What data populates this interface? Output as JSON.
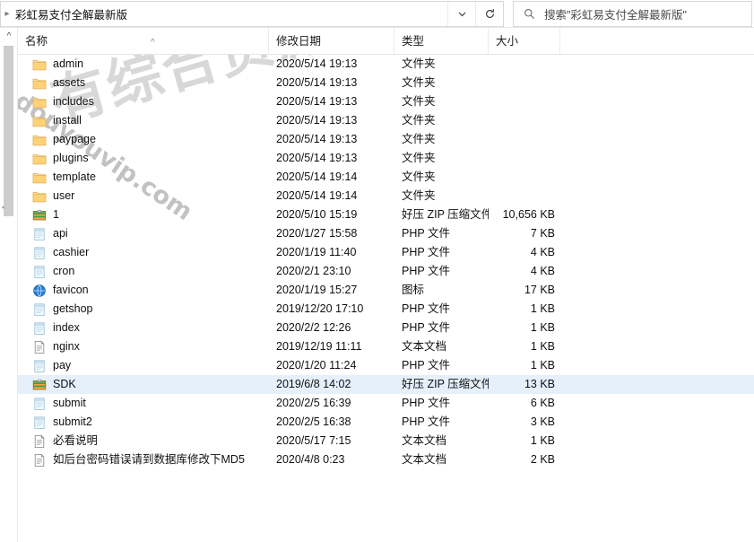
{
  "window": {
    "address_text": "彩虹易支付全解最新版",
    "dropdown_icon": "chevron-down-icon",
    "refresh_icon": "refresh-icon",
    "search_icon": "search-icon",
    "search_placeholder": "搜索\"彩虹易支付全解最新版\"",
    "nav_collapse_icon": "chevron-up-icon"
  },
  "watermark": {
    "chinese": "有综合资源网",
    "latin": "douyouvip.com"
  },
  "columns": {
    "name": "名称",
    "date": "修改日期",
    "type": "类型",
    "size": "大小",
    "sort_icon": "sort-ascending-icon"
  },
  "colors": {
    "selection": "#e5f0fb",
    "folder": "#ffd277",
    "php_icon": "#cfe6f5",
    "text_icon": "#ffffff",
    "zip_icon": "#3f9b4f",
    "favicon_icon": "#2a7fd4"
  },
  "rows": [
    {
      "name": "admin",
      "icon": "folder-icon",
      "date": "2020/5/14 19:13",
      "type": "文件夹",
      "size": ""
    },
    {
      "name": "assets",
      "icon": "folder-icon",
      "date": "2020/5/14 19:13",
      "type": "文件夹",
      "size": ""
    },
    {
      "name": "includes",
      "icon": "folder-icon",
      "date": "2020/5/14 19:13",
      "type": "文件夹",
      "size": ""
    },
    {
      "name": "install",
      "icon": "folder-icon",
      "date": "2020/5/14 19:13",
      "type": "文件夹",
      "size": ""
    },
    {
      "name": "paypage",
      "icon": "folder-icon",
      "date": "2020/5/14 19:13",
      "type": "文件夹",
      "size": ""
    },
    {
      "name": "plugins",
      "icon": "folder-icon",
      "date": "2020/5/14 19:13",
      "type": "文件夹",
      "size": ""
    },
    {
      "name": "template",
      "icon": "folder-icon",
      "date": "2020/5/14 19:14",
      "type": "文件夹",
      "size": ""
    },
    {
      "name": "user",
      "icon": "folder-icon",
      "date": "2020/5/14 19:14",
      "type": "文件夹",
      "size": ""
    },
    {
      "name": "1",
      "icon": "zip-icon",
      "date": "2020/5/10 15:19",
      "type": "好压 ZIP 压缩文件",
      "size": "10,656 KB"
    },
    {
      "name": "api",
      "icon": "php-icon",
      "date": "2020/1/27 15:58",
      "type": "PHP 文件",
      "size": "7 KB"
    },
    {
      "name": "cashier",
      "icon": "php-icon",
      "date": "2020/1/19 11:40",
      "type": "PHP 文件",
      "size": "4 KB"
    },
    {
      "name": "cron",
      "icon": "php-icon",
      "date": "2020/2/1 23:10",
      "type": "PHP 文件",
      "size": "4 KB"
    },
    {
      "name": "favicon",
      "icon": "favicon-icon",
      "date": "2020/1/19 15:27",
      "type": "图标",
      "size": "17 KB"
    },
    {
      "name": "getshop",
      "icon": "php-icon",
      "date": "2019/12/20 17:10",
      "type": "PHP 文件",
      "size": "1 KB"
    },
    {
      "name": "index",
      "icon": "php-icon",
      "date": "2020/2/2 12:26",
      "type": "PHP 文件",
      "size": "1 KB"
    },
    {
      "name": "nginx",
      "icon": "text-icon",
      "date": "2019/12/19 11:11",
      "type": "文本文档",
      "size": "1 KB"
    },
    {
      "name": "pay",
      "icon": "php-icon",
      "date": "2020/1/20 11:24",
      "type": "PHP 文件",
      "size": "1 KB"
    },
    {
      "name": "SDK",
      "icon": "zip-icon",
      "date": "2019/6/8 14:02",
      "type": "好压 ZIP 压缩文件",
      "size": "13 KB",
      "selected": true
    },
    {
      "name": "submit",
      "icon": "php-icon",
      "date": "2020/2/5 16:39",
      "type": "PHP 文件",
      "size": "6 KB"
    },
    {
      "name": "submit2",
      "icon": "php-icon",
      "date": "2020/2/5 16:38",
      "type": "PHP 文件",
      "size": "3 KB"
    },
    {
      "name": "必看说明",
      "icon": "text-icon",
      "date": "2020/5/17 7:15",
      "type": "文本文档",
      "size": "1 KB"
    },
    {
      "name": "如后台密码错误请到数据库修改下MD5",
      "icon": "text-icon",
      "date": "2020/4/8 0:23",
      "type": "文本文档",
      "size": "2 KB"
    }
  ]
}
